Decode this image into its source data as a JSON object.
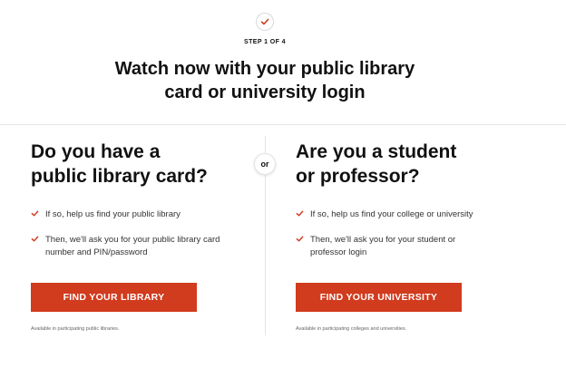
{
  "header": {
    "step_label": "STEP 1 OF 4",
    "headline_line1": "Watch now with your public library",
    "headline_line2": "card or university login"
  },
  "divider": {
    "or_label": "or"
  },
  "library_column": {
    "title_line1": "Do you have a",
    "title_line2": "public library card?",
    "check1": "If so, help us find your public library",
    "check2_line1": "Then, we'll ask you for your public library card",
    "check2_line2": "number and PIN/password",
    "button_label": "FIND YOUR LIBRARY",
    "note": "Available in participating public libraries."
  },
  "university_column": {
    "title_line1": "Are you a student",
    "title_line2": "or professor?",
    "check1": "If so, help us find your college or university",
    "check2_line1": "Then, we'll ask you for your student or",
    "check2_line2": "professor login",
    "button_label": "FIND YOUR UNIVERSITY",
    "note": "Available in participating colleges and universities."
  },
  "colors": {
    "accent": "#d13b1e",
    "text": "#111111",
    "muted": "#666666",
    "divider": "#e6e6e6"
  },
  "icons": {
    "step": "checkmark-icon",
    "bullet": "checkmark-icon"
  }
}
